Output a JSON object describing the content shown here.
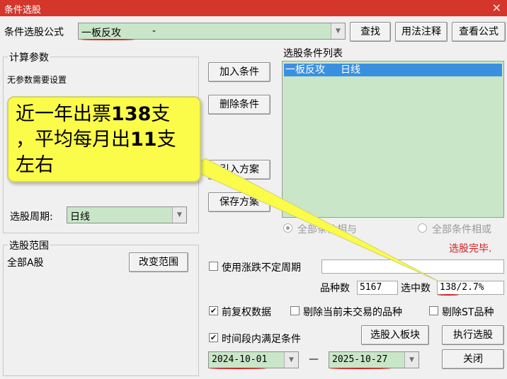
{
  "window": {
    "title": "条件选股",
    "close": "×"
  },
  "formula": {
    "label": "条件选股公式",
    "value": "一板反攻",
    "dash": "-"
  },
  "top_buttons": {
    "find": "查找",
    "usage": "用法注释",
    "view": "查看公式"
  },
  "params": {
    "legend": "计算参数",
    "text": "无参数需要设置",
    "period_label": "选股周期:",
    "period_value": "日线"
  },
  "mid_buttons": {
    "add": "加入条件",
    "delete": "删除条件",
    "import": "引入方案",
    "save": "保存方案"
  },
  "cond_list": {
    "title": "选股条件列表",
    "items": [
      {
        "name": "一板反攻",
        "period": "日线"
      }
    ]
  },
  "logic": {
    "and": "全部条件相与",
    "or": "全部条件相或",
    "and_selected": true
  },
  "status": "选股完毕.",
  "range": {
    "legend": "选股范围",
    "value": "全部A股",
    "change": "改变范围"
  },
  "options": {
    "use_period": "使用涨跌不定周期",
    "count_label": "品种数",
    "count_value": "5167",
    "selected_label": "选中数",
    "selected_value": "138/2.7%",
    "fq": "前复权数据",
    "exclude_untraded": "剔除当前未交易的品种",
    "exclude_st": "剔除ST品种",
    "time_range": "时间段内满足条件",
    "fq_checked": true,
    "exclude_untraded_checked": false,
    "exclude_st_checked": false,
    "time_range_checked": true
  },
  "dates": {
    "from": "2024-10-01",
    "sep": "—",
    "to": "2025-10-27"
  },
  "bottom_buttons": {
    "add_block": "选股入板块",
    "run": "执行选股",
    "close": "关闭"
  },
  "callout": {
    "line1a": "近一年出票",
    "line1b": "138",
    "line1c": "支",
    "line2a": "，平均每月出",
    "line2b": "11",
    "line2c": "支",
    "line3": "左右"
  },
  "colors": {
    "title_bar": "#d5362b",
    "list_bg": "#c9e6c9",
    "selection": "#3a90e0",
    "status": "#d61e1e",
    "callout": "#fbfb4a"
  }
}
